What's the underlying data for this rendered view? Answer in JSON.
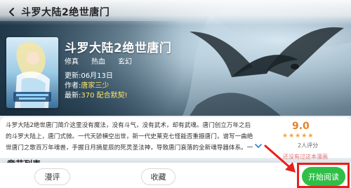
{
  "nav": {
    "title": "斗罗大陆2绝世唐门"
  },
  "book": {
    "title": "斗罗大陆2绝世唐门",
    "tags": [
      "修真",
      "热血",
      "玄幻"
    ],
    "update": {
      "label": "更新:",
      "value": "06月13日"
    },
    "author": {
      "label": "作者:",
      "value": "唐家三少"
    },
    "latest": {
      "label": "最新:",
      "value": "370 配合默契!"
    },
    "description": "斗罗大陆2绝世唐门简介这里没有魔法，没有斗气，没有武术，却有武魂。唐门创立万年之后的斗罗大陆上，唐门式微。一代天骄横空出世，新一代史莱克七怪能否重振唐门，谱写一曲绝世唐门之歌百万年魂兽，手握日月摘星辰的死灵圣法神，导致唐门衰落的全新魂导器体系。一切的神奇都将"
  },
  "rating": {
    "score": "9.0",
    "stars": 5,
    "count": "2人评分",
    "hint": "还没有过这本漫画"
  },
  "sections": {
    "chapters_title": "章节列表"
  },
  "actions": {
    "review": "漫评",
    "collect": "收藏",
    "start_read": "开始阅读"
  },
  "colors": {
    "accent_green": "#2fbf47",
    "rating_orange": "#e5822a",
    "highlight_red": "#e8201c"
  }
}
